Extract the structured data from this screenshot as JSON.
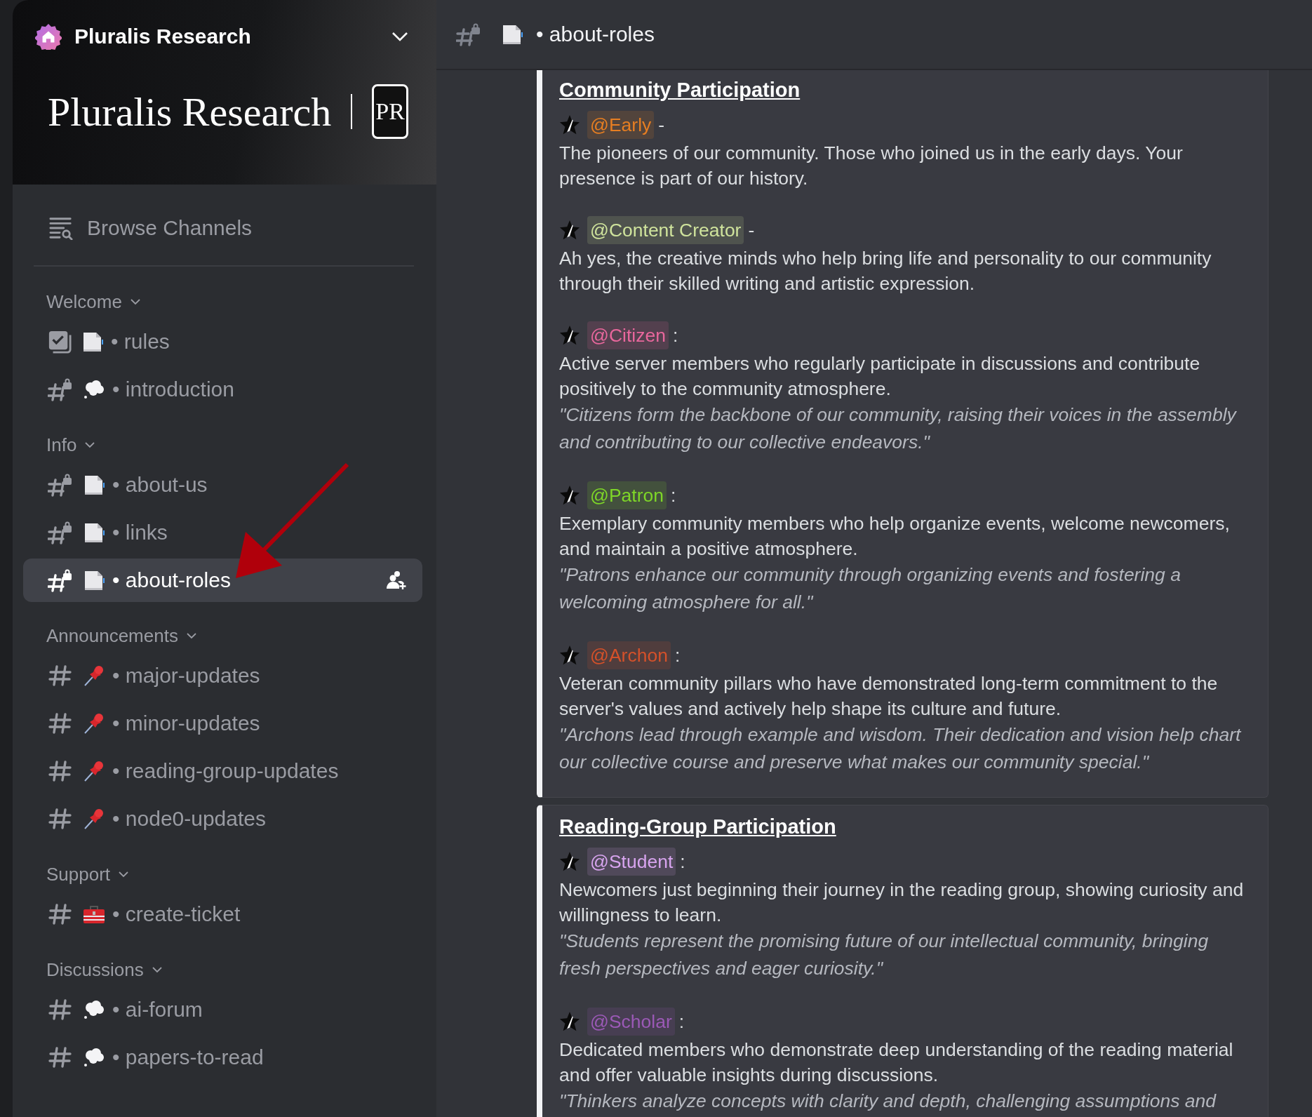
{
  "server": {
    "name": "Pluralis Research",
    "banner_title": "Pluralis Research",
    "banner_badge": "PR"
  },
  "browse": {
    "label": "Browse Channels"
  },
  "categories": [
    {
      "name": "Welcome",
      "expanded": true,
      "channels": [
        {
          "kind": "rules_page",
          "name": "• rules",
          "selected": false
        },
        {
          "kind": "locked_cloud",
          "name": "• introduction",
          "selected": false
        }
      ]
    },
    {
      "name": "Info",
      "expanded": true,
      "channels": [
        {
          "kind": "locked_page",
          "name": "• about-us",
          "selected": false
        },
        {
          "kind": "locked_page",
          "name": "• links",
          "selected": false
        },
        {
          "kind": "locked_page",
          "name": "• about-roles",
          "selected": true
        }
      ]
    },
    {
      "name": "Announcements",
      "expanded": true,
      "channels": [
        {
          "kind": "text_pin",
          "name": "• major-updates",
          "selected": false
        },
        {
          "kind": "text_pin",
          "name": "• minor-updates",
          "selected": false
        },
        {
          "kind": "text_pin",
          "name": "• reading-group-updates",
          "selected": false
        },
        {
          "kind": "text_pin",
          "name": "• node0-updates",
          "selected": false
        }
      ]
    },
    {
      "name": "Support",
      "expanded": true,
      "channels": [
        {
          "kind": "text_toolbox",
          "name": "• create-ticket",
          "selected": false
        }
      ]
    },
    {
      "name": "Discussions",
      "expanded": true,
      "channels": [
        {
          "kind": "text_cloud",
          "name": "• ai-forum",
          "selected": false
        },
        {
          "kind": "text_cloud",
          "name": "• papers-to-read",
          "selected": false
        }
      ]
    }
  ],
  "topbar": {
    "kind": "locked_page",
    "name": "• about-roles"
  },
  "embeds": [
    {
      "title": "Community Participation",
      "roles": [
        {
          "mention": "@Early",
          "color": "#e67e22",
          "separator": "-",
          "description": "The pioneers of our community. Those who joined us in the early days. Your presence is part of our history."
        },
        {
          "mention": "@Content Creator",
          "color": "#cfe39c",
          "separator": "-",
          "description": "Ah yes, the creative minds who help bring life and personality to our community through their skilled writing and artistic expression."
        },
        {
          "mention": "@Citizen",
          "color": "#e8679c",
          "separator": ":",
          "description": "Active server members who regularly participate in discussions and contribute positively to the community atmosphere.",
          "quote": "\"Citizens form the backbone of our community, raising their voices in the assembly and contributing to our collective endeavors.\""
        },
        {
          "mention": "@Patron",
          "color": "#7ed628",
          "separator": ":",
          "description": "Exemplary community members who help organize events, welcome newcomers, and maintain a positive atmosphere.",
          "quote": "\"Patrons enhance our community through organizing events and fostering a welcoming atmosphere for all.\""
        },
        {
          "mention": "@Archon",
          "color": "#d4512a",
          "separator": ":",
          "description": "Veteran community pillars who have demonstrated long-term commitment to the server's values and actively help shape its culture and future.",
          "quote": "\"Archons lead through example and wisdom. Their dedication and vision help chart our collective course and preserve what makes our community special.\""
        }
      ]
    },
    {
      "title": "Reading-Group Participation",
      "roles": [
        {
          "mention": "@Student",
          "color": "#d7a4ee",
          "separator": ":",
          "description": "Newcomers just beginning their journey in the reading group, showing curiosity and willingness to learn.",
          "quote": "\"Students represent the promising future of our intellectual community, bringing fresh perspectives and eager curiosity.\""
        },
        {
          "mention": "@Scholar",
          "color": "#9b59b6",
          "separator": ":",
          "description": "Dedicated members who demonstrate deep understanding of the reading material and offer valuable insights during discussions.",
          "quote": "\"Thinkers analyze concepts with clarity and depth, challenging assumptions and"
        }
      ]
    }
  ]
}
